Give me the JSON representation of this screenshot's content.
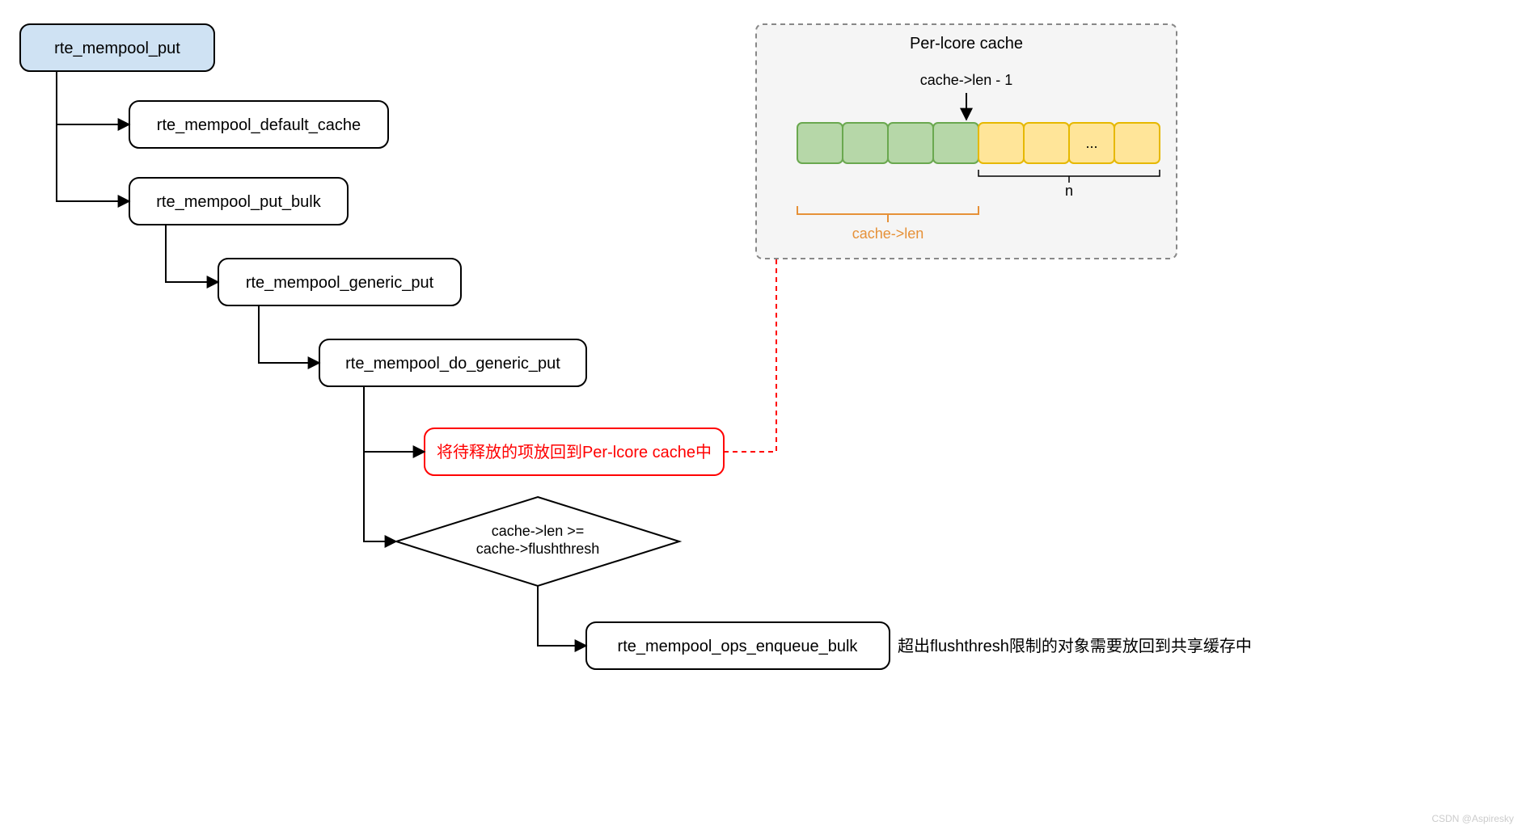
{
  "flow": {
    "start": "rte_mempool_put",
    "step1": "rte_mempool_default_cache",
    "step2": "rte_mempool_put_bulk",
    "step3": "rte_mempool_generic_put",
    "step4": "rte_mempool_do_generic_put",
    "step5_red": "将待释放的项放回到Per-lcore cache中",
    "decision_line1": "cache->len >=",
    "decision_line2": "cache->flushthresh",
    "step6": "rte_mempool_ops_enqueue_bulk",
    "step6_note": "超出flushthresh限制的对象需要放回到共享缓存中"
  },
  "cache_panel": {
    "title": "Per-lcore cache",
    "pointer_label": "cache->len - 1",
    "green_cells": 4,
    "yellow_cells": 4,
    "yellow_ellipsis_index": 2,
    "bracket_green": "cache->len",
    "bracket_yellow": "n"
  },
  "watermark": "CSDN @Aspiresky"
}
